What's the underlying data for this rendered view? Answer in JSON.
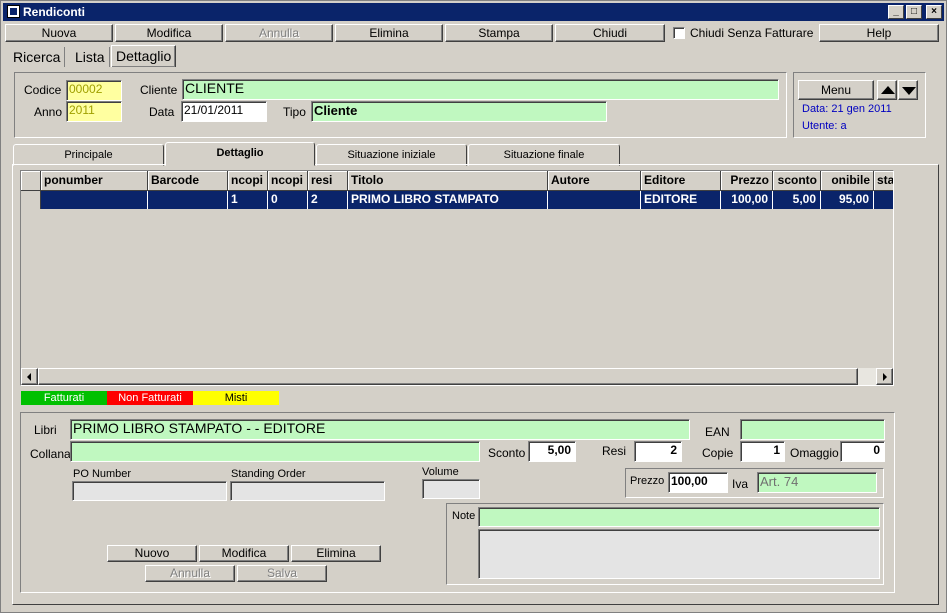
{
  "window": {
    "title": "Rendiconti"
  },
  "toolbar": {
    "nuova": "Nuova",
    "modifica": "Modifica",
    "annulla": "Annulla",
    "elimina": "Elimina",
    "stampa": "Stampa",
    "chiudi": "Chiudi",
    "chiudi_senza_fatturare": "Chiudi Senza Fatturare",
    "help": "Help"
  },
  "view_tabs": [
    "Ricerca",
    "Lista",
    "Dettaglio"
  ],
  "header": {
    "codice_label": "Codice",
    "codice": "00002",
    "anno_label": "Anno",
    "anno": "2011",
    "cliente_label": "Cliente",
    "cliente": "CLIENTE",
    "data_label": "Data",
    "data": "21/01/2011",
    "tipo_label": "Tipo",
    "tipo": "Cliente",
    "menu": "Menu",
    "info_data": "Data: 21 gen 2011",
    "info_utente": "Utente: a"
  },
  "tabs": [
    "Principale",
    "Dettaglio",
    "Situazione iniziale",
    "Situazione finale"
  ],
  "grid": {
    "columns": [
      "ponumber",
      "Barcode",
      "ncopi",
      "ncopi",
      "resi",
      "Titolo",
      "Autore",
      "Editore",
      "Prezzo",
      "sconto",
      "onibile",
      "sta"
    ],
    "rows": [
      [
        "",
        "",
        "1",
        "0",
        "2",
        "PRIMO LIBRO STAMPATO",
        "",
        "EDITORE",
        "100,00",
        "5,00",
        "95,00",
        ""
      ]
    ]
  },
  "legend": {
    "fatturati": "Fatturati",
    "non_fatturati": "Non Fatturati",
    "misti": "Misti",
    "colors": {
      "fatturati": "#00c000",
      "non_fatturati": "#ff0000",
      "misti": "#ffff00"
    }
  },
  "detail": {
    "libri_label": "Libri",
    "libri": "PRIMO LIBRO STAMPATO -  - EDITORE",
    "ean_label": "EAN",
    "ean": "",
    "collana_label": "Collana",
    "collana": "",
    "sconto_label": "Sconto",
    "sconto": "5,00",
    "resi_label": "Resi",
    "resi": "2",
    "copie_label": "Copie",
    "copie": "1",
    "omaggio_label": "Omaggio",
    "omaggio": "0",
    "po_label": "PO Number",
    "po": "",
    "standing_label": "Standing Order",
    "standing": "",
    "volume_label": "Volume",
    "volume": "",
    "prezzo_label": "Prezzo",
    "prezzo": "100,00",
    "iva_label": "Iva",
    "iva": "Art. 74",
    "note_label": "Note",
    "note": "",
    "note_ext": ""
  },
  "detail_buttons": {
    "nuovo": "Nuovo",
    "modifica": "Modifica",
    "elimina": "Elimina",
    "annulla": "Annulla",
    "salva": "Salva"
  }
}
